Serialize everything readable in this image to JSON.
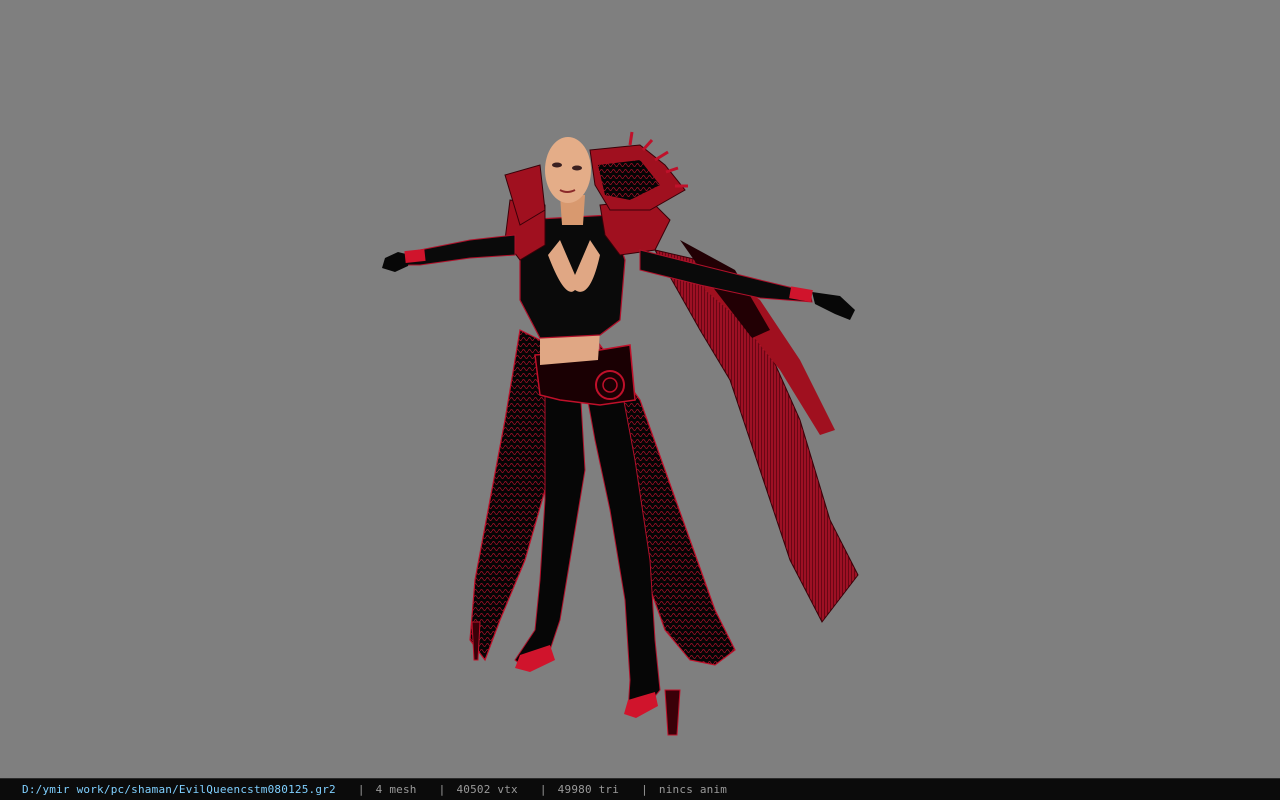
{
  "viewer": {
    "background_color": "#7f7f7f",
    "model": {
      "subject": "evil-queen-costume-character",
      "primary_colors": [
        "#000000",
        "#c0102a",
        "#e0a784"
      ]
    }
  },
  "status_bar": {
    "file_path": "D:/ymir work/pc/shaman/EvilQueencstm080125.gr2",
    "separator": "|",
    "mesh_count": "4 mesh",
    "vertex_count": "40502 vtx",
    "triangle_count": "49980 tri",
    "anim_info": "nincs anim",
    "path_color": "#7fd0ff",
    "stat_color": "#9a9a9a"
  }
}
